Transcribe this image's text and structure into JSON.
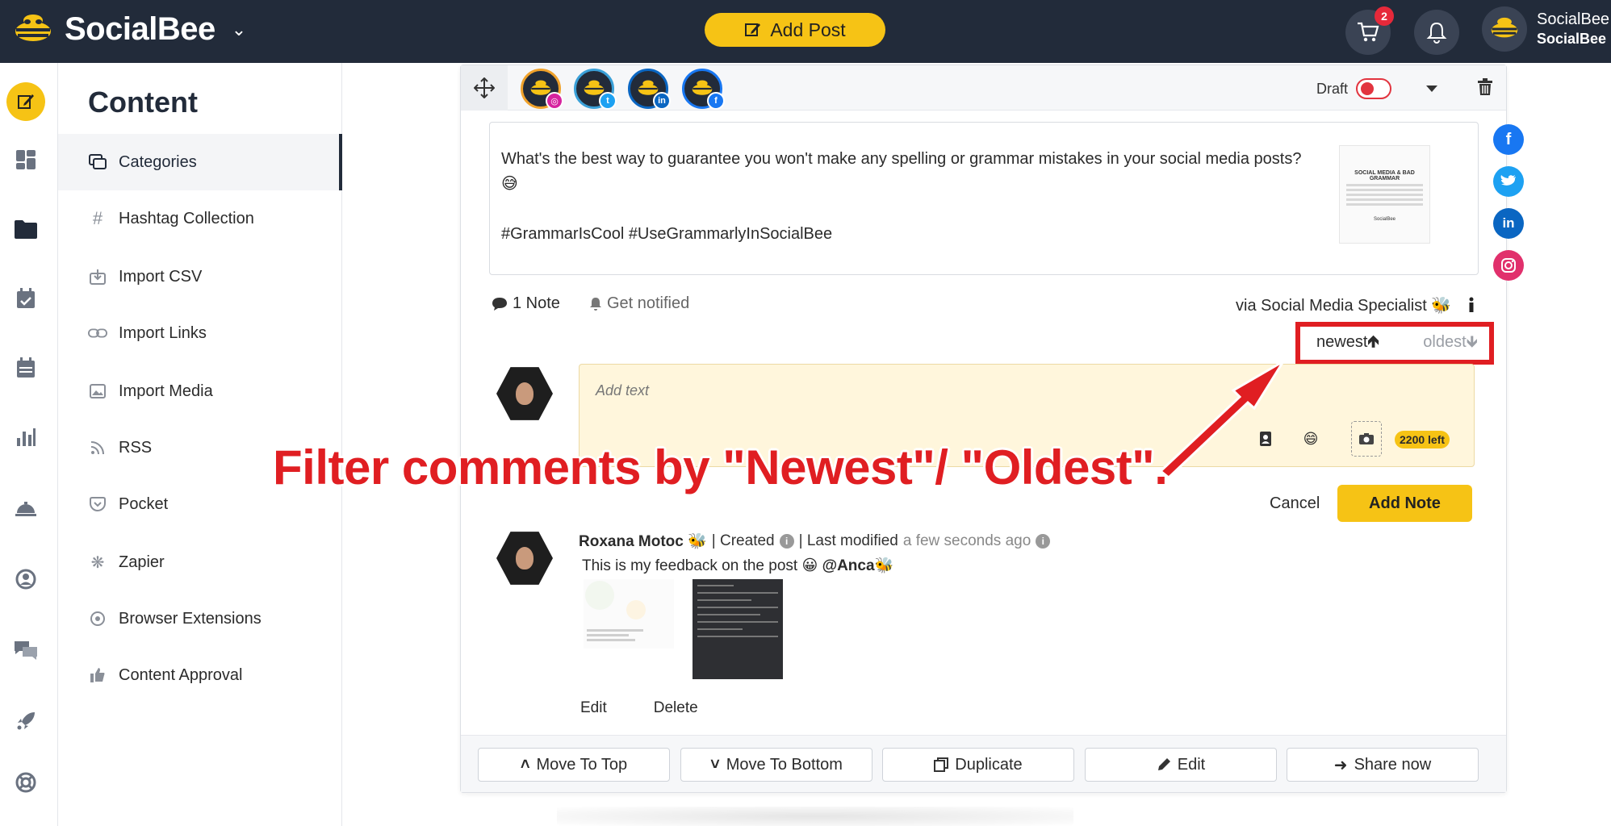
{
  "topbar": {
    "brand": "SocialBee",
    "add_post_label": "Add Post",
    "cart_count": "2",
    "account_name": "SocialBee",
    "account_workspace": "SocialBee"
  },
  "rail": {
    "items": [
      "compose-icon",
      "dashboard-icon",
      "content-folder-icon",
      "schedule-icon",
      "calendar-icon",
      "analytics-icon",
      "concierge-icon",
      "audience-icon",
      "engage-icon",
      "rocket-icon",
      "help-icon"
    ],
    "active_index": 0
  },
  "sidebar": {
    "title": "Content",
    "items": [
      {
        "label": "Categories",
        "icon": "categories-icon",
        "active": true
      },
      {
        "label": "Hashtag Collection",
        "icon": "hashtag-icon"
      },
      {
        "label": "Import CSV",
        "icon": "import-csv-icon"
      },
      {
        "label": "Import Links",
        "icon": "link-icon"
      },
      {
        "label": "Import Media",
        "icon": "image-icon"
      },
      {
        "label": "RSS",
        "icon": "rss-icon"
      },
      {
        "label": "Pocket",
        "icon": "pocket-icon"
      },
      {
        "label": "Zapier",
        "icon": "zapier-icon"
      },
      {
        "label": "Browser Extensions",
        "icon": "browser-extension-icon"
      },
      {
        "label": "Content Approval",
        "icon": "thumbs-up-icon"
      }
    ]
  },
  "post": {
    "profiles": [
      {
        "network": "instagram",
        "color": "#d6249f"
      },
      {
        "network": "twitter",
        "color": "#1da1f2"
      },
      {
        "network": "linkedin",
        "color": "#0a66c2"
      },
      {
        "network": "facebook",
        "color": "#1877f2"
      }
    ],
    "draft_label": "Draft",
    "text_line": "What's the best way to guarantee you won't make any spelling or grammar mistakes in your social media posts? 😅",
    "hashtags": "#GrammarIsCool #UseGrammarlyInSocialBee",
    "thumb_title": "SOCIAL MEDIA & BAD GRAMMAR",
    "thumb_brand": "SocialBee",
    "notes_label": "1 Note",
    "notify_label": "Get notified",
    "via_label": "via Social Media Specialist 🐝"
  },
  "sort": {
    "newest": "newest",
    "oldest": "oldest"
  },
  "compose": {
    "placeholder": "Add text",
    "chars_left": "2200 left",
    "cancel_label": "Cancel",
    "add_note_label": "Add Note"
  },
  "comment": {
    "author": "Roxana Motoc 🐝",
    "created_label": "| Created",
    "modified_label": "| Last modified",
    "modified_ago": "a few seconds ago",
    "body": "This is my feedback on the post 😀",
    "mention": "@Anca🐝",
    "edit_label": "Edit",
    "delete_label": "Delete"
  },
  "footer": {
    "move_top": "Move To Top",
    "move_bottom": "Move To Bottom",
    "duplicate": "Duplicate",
    "edit": "Edit",
    "share_now": "Share now"
  },
  "share_float": [
    {
      "network": "facebook",
      "color": "#1877f2"
    },
    {
      "network": "twitter",
      "color": "#1da1f2"
    },
    {
      "network": "linkedin",
      "color": "#0a66c2"
    },
    {
      "network": "instagram",
      "color": "#e1306c"
    }
  ],
  "annotation": {
    "text": "Filter comments by \"Newest\"/ \"Oldest\".",
    "color": "#e01e22"
  },
  "colors": {
    "accent": "#f6c315",
    "topbar": "#222b3a",
    "highlight": "#e01e22"
  }
}
